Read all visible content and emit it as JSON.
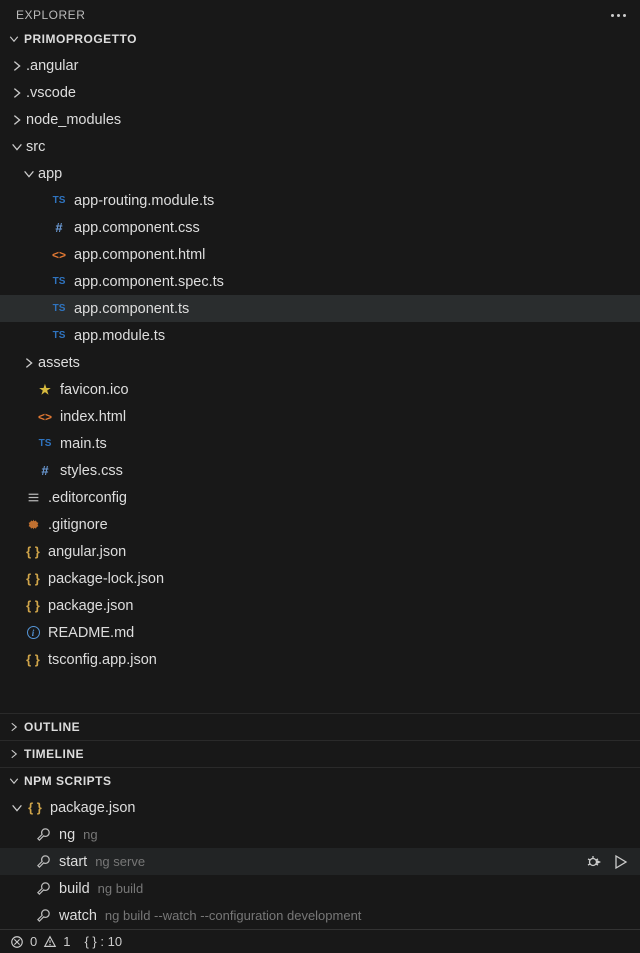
{
  "header": {
    "title": "EXPLORER"
  },
  "project": {
    "name": "PRIMOPROGETTO"
  },
  "tree": [
    {
      "label": ".angular",
      "kind": "folder",
      "expanded": false,
      "indent": 0
    },
    {
      "label": ".vscode",
      "kind": "folder",
      "expanded": false,
      "indent": 0
    },
    {
      "label": "node_modules",
      "kind": "folder",
      "expanded": false,
      "indent": 0
    },
    {
      "label": "src",
      "kind": "folder",
      "expanded": true,
      "indent": 0
    },
    {
      "label": "app",
      "kind": "folder",
      "expanded": true,
      "indent": 1
    },
    {
      "label": "app-routing.module.ts",
      "kind": "ts",
      "indent": 2
    },
    {
      "label": "app.component.css",
      "kind": "css",
      "indent": 2
    },
    {
      "label": "app.component.html",
      "kind": "html",
      "indent": 2
    },
    {
      "label": "app.component.spec.ts",
      "kind": "ts",
      "indent": 2
    },
    {
      "label": "app.component.ts",
      "kind": "ts",
      "indent": 2,
      "selected": true
    },
    {
      "label": "app.module.ts",
      "kind": "ts",
      "indent": 2
    },
    {
      "label": "assets",
      "kind": "folder",
      "expanded": false,
      "indent": 1
    },
    {
      "label": "favicon.ico",
      "kind": "star",
      "indent": 1
    },
    {
      "label": "index.html",
      "kind": "html",
      "indent": 1
    },
    {
      "label": "main.ts",
      "kind": "ts",
      "indent": 1
    },
    {
      "label": "styles.css",
      "kind": "css",
      "indent": 1
    },
    {
      "label": ".editorconfig",
      "kind": "editorconfig",
      "indent": 0
    },
    {
      "label": ".gitignore",
      "kind": "gear",
      "indent": 0
    },
    {
      "label": "angular.json",
      "kind": "json",
      "indent": 0
    },
    {
      "label": "package-lock.json",
      "kind": "json",
      "indent": 0
    },
    {
      "label": "package.json",
      "kind": "json",
      "indent": 0
    },
    {
      "label": "README.md",
      "kind": "info",
      "indent": 0
    },
    {
      "label": "tsconfig.app.json",
      "kind": "json",
      "indent": 0
    }
  ],
  "sections": {
    "outline": "OUTLINE",
    "timeline": "TIMELINE",
    "npm": "NPM SCRIPTS"
  },
  "npm": {
    "file": "package.json",
    "scripts": [
      {
        "name": "ng",
        "cmd": "ng"
      },
      {
        "name": "start",
        "cmd": "ng serve",
        "hovered": true
      },
      {
        "name": "build",
        "cmd": "ng build"
      },
      {
        "name": "watch",
        "cmd": "ng build --watch --configuration development"
      }
    ]
  },
  "status": {
    "err": "0",
    "warn": "1",
    "ln": "{ } : 10"
  }
}
